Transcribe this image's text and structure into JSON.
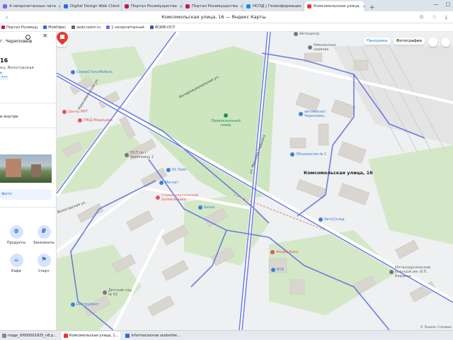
{
  "browser": {
    "tabs": [
      {
        "label": "4 непрочитанных чата",
        "color": "#8a5cf5"
      },
      {
        "label": "Digital Design Web Client",
        "color": "#2d6bd8"
      },
      {
        "label": "Портал Росимущества",
        "color": "#c2185b"
      },
      {
        "label": "Портал Росимущества",
        "color": "#c2185b"
      },
      {
        "label": "НСПД | Геоинформацио",
        "color": "#1e88e5"
      },
      {
        "label": "Комсомольская улица,",
        "color": "#e53935",
        "active": true
      }
    ],
    "new_tab": "+",
    "window_title": "Комсомольская улица, 16 — Яндекс Карты",
    "bookmarks": [
      {
        "label": "Портал Росимущ",
        "color": "#c2185b"
      },
      {
        "label": "МойОфис",
        "color": "#2d6bd8"
      },
      {
        "label": "sedo.rosim.ru",
        "color": "#666666"
      },
      {
        "label": "1 непрочитанный",
        "color": "#8a5cf5"
      },
      {
        "label": "ФОИВ-ОСП",
        "color": "#3f51b5"
      }
    ]
  },
  "panel": {
    "search_query": "г. Череповец",
    "address_number": "16",
    "region": "ец, Вологодская",
    "region2": "ь",
    "dots": "•••",
    "inside": "и внутри",
    "add_photo": "фото",
    "categories": [
      {
        "label": "Продукты",
        "icon": "cart-icon",
        "glyph": "⊗"
      },
      {
        "label": "Банкоматы",
        "icon": "ruble-icon",
        "glyph": "₽"
      },
      {
        "label": "Кафе",
        "icon": "cafe-icon",
        "glyph": "☕"
      },
      {
        "label": "Спорт",
        "icon": "sport-icon",
        "glyph": "⚑"
      }
    ]
  },
  "map": {
    "tools": [
      "Панорамы",
      "Фотографии"
    ],
    "selected_label": "Комсомольская улица, 16",
    "copyright": "© Яндекс  Справка",
    "streets": [
      {
        "text": "Комсомольская ул.",
        "rot": -58
      },
      {
        "text": "Интернациональная ул.",
        "rot": -28
      },
      {
        "text": "Вологодская ул.",
        "rot": -20
      },
      {
        "text": "ул. Максима Горького",
        "rot": -70
      }
    ],
    "places": [
      {
        "text": "СеверСтильМебель",
        "color": "#3f7fd6"
      },
      {
        "text": "Центр МРТ",
        "color": "#e0575b"
      },
      {
        "text": "РЖД-Медицина",
        "color": "#e0575b"
      },
      {
        "text": "Привокзальный сквер",
        "color": "#2e8b57"
      },
      {
        "text": "автовокзал Череповец",
        "color": "#3f7fd6"
      },
      {
        "text": "Общежитие № 1",
        "color": "#3f7fd6"
      },
      {
        "text": "ОСП по г. Череповцу 2",
        "color": "#777777"
      },
      {
        "text": "60 Лайт",
        "color": "#3f7fd6"
      },
      {
        "text": "Магнит",
        "color": "#3f7fd6"
      },
      {
        "text": "Стоматологическая поликлиника",
        "color": "#e0575b"
      },
      {
        "text": "Бизон",
        "color": "#3f7fd6"
      },
      {
        "text": "АвтоСклад",
        "color": "#3f7fd6"
      },
      {
        "text": "Альфа-Банк",
        "color": "#e0575b"
      },
      {
        "text": "ВТБ",
        "color": "#3f7fd6"
      },
      {
        "text": "Детский сад № 62",
        "color": "#777777"
      },
      {
        "text": "Инструмент",
        "color": "#3f7fd6"
      },
      {
        "text": "Металлургический колледж им. И.П. Бардина",
        "color": "#777777"
      },
      {
        "text": "Автоцентр",
        "color": "#777777"
      },
      {
        "text": "Никольская церковь",
        "color": "#777777"
      }
    ]
  },
  "taskbar": [
    {
      "label": "mage_t0000001925_n8.p...",
      "color": "#888888"
    },
    {
      "label": "Комсомольская улица, 1...",
      "color": "#e53935",
      "active": true
    },
    {
      "label": "Informacionnoe soobshhe...",
      "color": "#2d6bd8"
    }
  ]
}
